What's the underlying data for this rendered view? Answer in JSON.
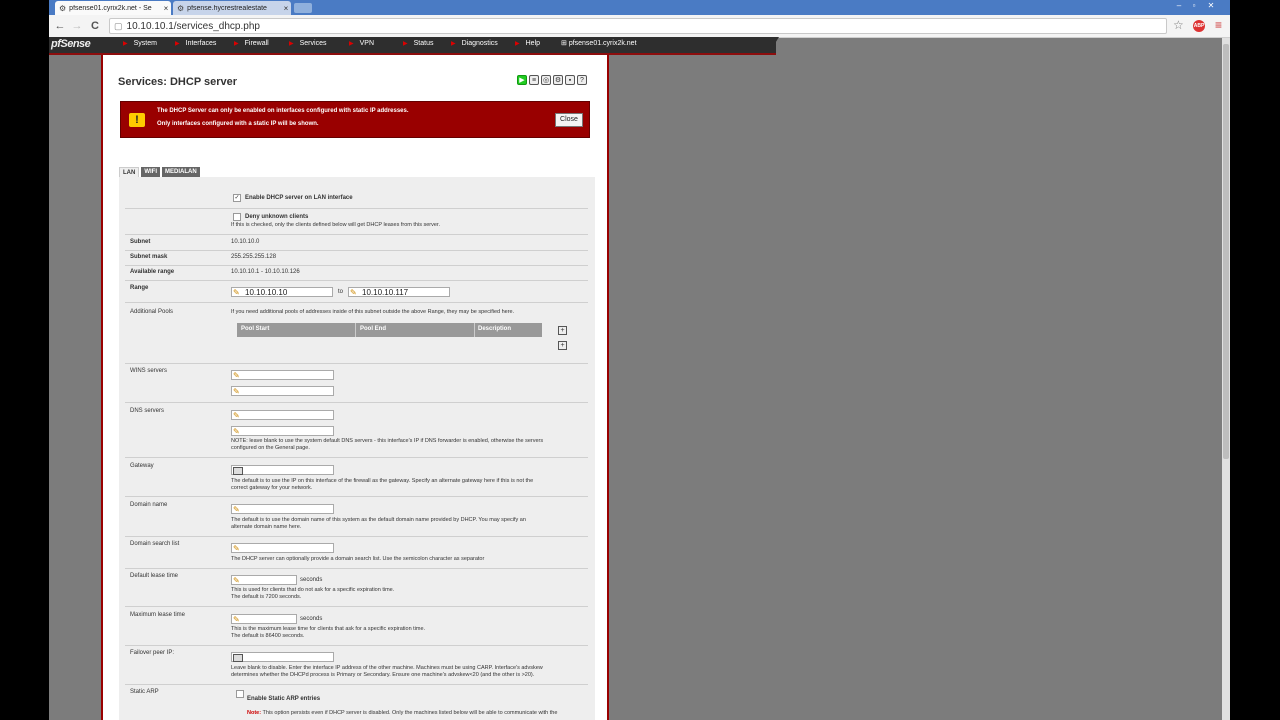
{
  "browser": {
    "tabs": [
      {
        "label": "pfsense01.cyrix2k.net - Se",
        "close": "×"
      },
      {
        "label": "pfsense.hycrestrealestate",
        "close": "×"
      }
    ],
    "url": "10.10.10.1/services_dhcp.php",
    "nav": {
      "back": "←",
      "forward": "→",
      "reload": "C"
    },
    "star": "☆",
    "abp": "ABP",
    "menu": "≡"
  },
  "pfsense": {
    "logo": "pfSense",
    "menu": [
      "System",
      "Interfaces",
      "Firewall",
      "Services",
      "VPN",
      "Status",
      "Diagnostics",
      "Help"
    ],
    "hostname": "pfsense01.cyrix2k.net"
  },
  "page": {
    "title": "Services: DHCP server",
    "alert": {
      "line1": "The DHCP Server can only be enabled on interfaces configured with static IP addresses.",
      "line2": "Only interfaces configured with a static IP will be shown.",
      "close": "Close"
    },
    "tabs": [
      "LAN",
      "WIFI",
      "MEDIALAN"
    ],
    "enable_label": "Enable DHCP server on LAN interface",
    "deny_label": "Deny unknown clients",
    "deny_note": "If this is checked, only the clients defined below will get DHCP leases from this server.",
    "subnet": {
      "label": "Subnet",
      "value": "10.10.10.0"
    },
    "subnet_mask": {
      "label": "Subnet mask",
      "value": "255.255.255.128"
    },
    "available_range": {
      "label": "Available range",
      "value": "10.10.10.1 - 10.10.10.126"
    },
    "range": {
      "label": "Range",
      "from": "10.10.10.10",
      "to_word": "to",
      "to": "10.10.10.117"
    },
    "additional_pools": {
      "label": "Additional Pools",
      "note": "If you need additional pools of addresses inside of this subnet outside the above Range, they may be specified here.",
      "columns": [
        "Pool Start",
        "Pool End",
        "Description"
      ]
    },
    "wins": {
      "label": "WINS servers"
    },
    "dns": {
      "label": "DNS servers",
      "note1": "NOTE: leave blank to use the system default DNS servers - this interface's IP if DNS forwarder is enabled, otherwise the servers",
      "note2": "configured on the General page."
    },
    "gateway": {
      "label": "Gateway",
      "note1": "The default is to use the IP on this interface of the firewall as the gateway. Specify an alternate gateway here if this is not the",
      "note2": "correct gateway for your network."
    },
    "domain_name": {
      "label": "Domain name",
      "note1": "The default is to use the domain name of this system as the default domain name provided by DHCP. You may specify an",
      "note2": "alternate domain name here."
    },
    "domain_search": {
      "label": "Domain search list",
      "note": "The DHCP server can optionally provide a domain search list. Use the semicolon character as separator"
    },
    "default_lease": {
      "label": "Default lease time",
      "unit": "seconds",
      "note1": "This is used for clients that do not ask for a specific expiration time.",
      "note2": "The default is 7200 seconds."
    },
    "max_lease": {
      "label": "Maximum lease time",
      "unit": "seconds",
      "note1": "This is the maximum lease time for clients that ask for a specific expiration time.",
      "note2": "The default is 86400 seconds."
    },
    "failover": {
      "label": "Failover peer IP:",
      "note1": "Leave blank to disable. Enter the interface IP address of the other machine. Machines must be using CARP. Interface's advskew",
      "note2": "determines whether the DHCPd process is Primary or Secondary. Ensure one machine's advskew<20 (and the other is >20)."
    },
    "static_arp": {
      "label": "Static ARP",
      "check_label": "Enable Static ARP entries",
      "note_bold": "Note:",
      "note": "This option persists even if DHCP server is disabled. Only the machines listed below will be able to communicate with the"
    }
  }
}
